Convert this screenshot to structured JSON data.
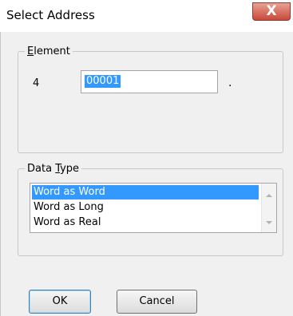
{
  "window": {
    "title": "Select Address",
    "close_glyph": "X"
  },
  "element_group": {
    "legend_prefix": "",
    "legend_accel": "E",
    "legend_rest": "lement",
    "number": "4",
    "value": "00001",
    "suffix": "."
  },
  "datatype_group": {
    "legend_prefix": "Data ",
    "legend_accel": "T",
    "legend_rest": "ype",
    "options": [
      "Word as Word",
      "Word as Long",
      "Word as Real"
    ],
    "selected": "Word as Word"
  },
  "buttons": {
    "ok": "OK",
    "cancel": "Cancel"
  },
  "colors": {
    "selection": "#3399ff",
    "close": "#c9483a"
  },
  "icons": [
    "close-icon",
    "scroll-up-icon",
    "scroll-down-icon"
  ]
}
